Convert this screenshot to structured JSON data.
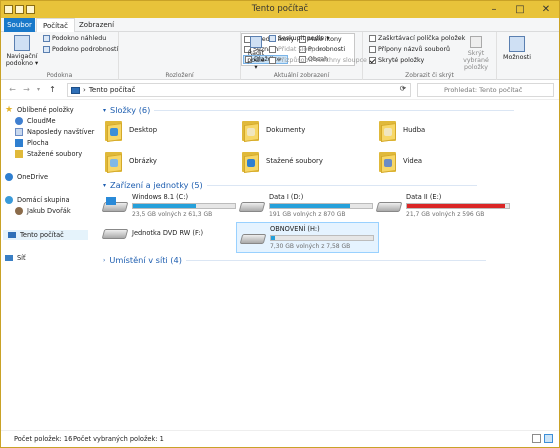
{
  "window": {
    "title": "Tento počítač",
    "controls": {
      "minimize": "–",
      "maximize": "□",
      "close": "✕"
    }
  },
  "ribbon_tabs": [
    {
      "label": "Soubor"
    },
    {
      "label": "Počítač"
    },
    {
      "label": "Zobrazení"
    }
  ],
  "ribbon": {
    "panes": {
      "nav_pane_label": "Navigační podokno ▾",
      "preview_pane": "Podokno náhledu",
      "details_pane": "Podokno podrobností",
      "group_label": "Podokna"
    },
    "layout": {
      "options": [
        "Střední ikony",
        "Malé ikony",
        "Seznam",
        "Podrobnosti",
        "Dlaždice",
        "Obsah"
      ],
      "group_label": "Rozložení"
    },
    "current_view": {
      "sort_by": "Řadit podle ▾",
      "group_by": "Seskupit podle ▾",
      "add_columns": "Přidat sloupce ▾",
      "fit_columns": "Přizpůsobit všechny sloupce",
      "group_label": "Aktuální zobrazení"
    },
    "show_hide": {
      "item_checkboxes": "Zaškrtávací políčka položek",
      "file_extensions": "Přípony názvů souborů",
      "hidden_items": "Skryté položky",
      "hide_selected": "Skrýt vybrané položky",
      "group_label": "Zobrazit či skrýt"
    },
    "options_label": "Možnosti"
  },
  "address": {
    "back": "←",
    "forward": "→",
    "recent": "▾",
    "up": "↑",
    "path": "Tento počítač",
    "separator": "›",
    "dropdown": "▾",
    "refresh": "⟳",
    "search_placeholder": "Prohledat: Tento počítač"
  },
  "nav": {
    "favorites": "Oblíbené položky",
    "fav_items": [
      "CloudMe",
      "Naposledy navštíver",
      "Plocha",
      "Stažené soubory"
    ],
    "onedrive": "OneDrive",
    "homegroup": "Domácí skupina",
    "homegroup_user": "Jakub Dvořák",
    "this_pc": "Tento počítač",
    "network": "Síť"
  },
  "sections": {
    "folders": "Složky (6)",
    "devices": "Zařízení a jednotky (5)",
    "network": "Umístění v síti (4)"
  },
  "folders": [
    {
      "name": "Desktop",
      "badge_color": "#3c8fd8"
    },
    {
      "name": "Dokumenty",
      "badge_color": "#f0e6c0"
    },
    {
      "name": "Hudba",
      "badge_color": "#f0e6c0"
    },
    {
      "name": "Obrázky",
      "badge_color": "#7fb8e6"
    },
    {
      "name": "Stažené soubory",
      "badge_color": "#2f7fd0"
    },
    {
      "name": "Videa",
      "badge_color": "#6b8cc4"
    }
  ],
  "drives": [
    {
      "name": "Windows 8.1 (C:)",
      "free": "23,5 GB volných z 61,3 GB",
      "used_fraction": 0.62,
      "color": "#26a0da"
    },
    {
      "name": "Data I (D:)",
      "free": "191 GB volných z 870 GB",
      "used_fraction": 0.78,
      "color": "#26a0da"
    },
    {
      "name": "Data II (E:)",
      "free": "21,7 GB volných z 596 GB",
      "used_fraction": 0.96,
      "color": "#da2626"
    },
    {
      "name": "Jednotka DVD RW (F:)"
    },
    {
      "name": "OBNOVENÍ (H:)",
      "free": "7,30 GB volných z 7,58 GB",
      "used_fraction": 0.04,
      "color": "#26a0da"
    }
  ],
  "status": {
    "item_count": "Počet položek: 16",
    "selected_count": "Počet vybraných položek: 1"
  }
}
